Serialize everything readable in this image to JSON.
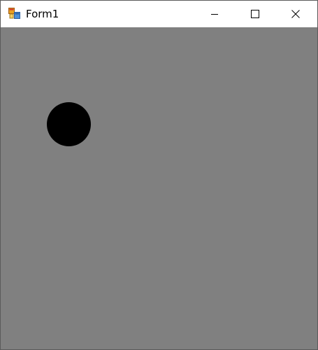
{
  "window": {
    "title": "Form1",
    "icon": "winforms-app-icon"
  },
  "caption_buttons": {
    "minimize_icon": "minimize-icon",
    "maximize_icon": "maximize-icon",
    "close_icon": "close-icon"
  },
  "canvas": {
    "background_color": "#808080",
    "shape_color": "#000000",
    "shape_type": "circle"
  }
}
